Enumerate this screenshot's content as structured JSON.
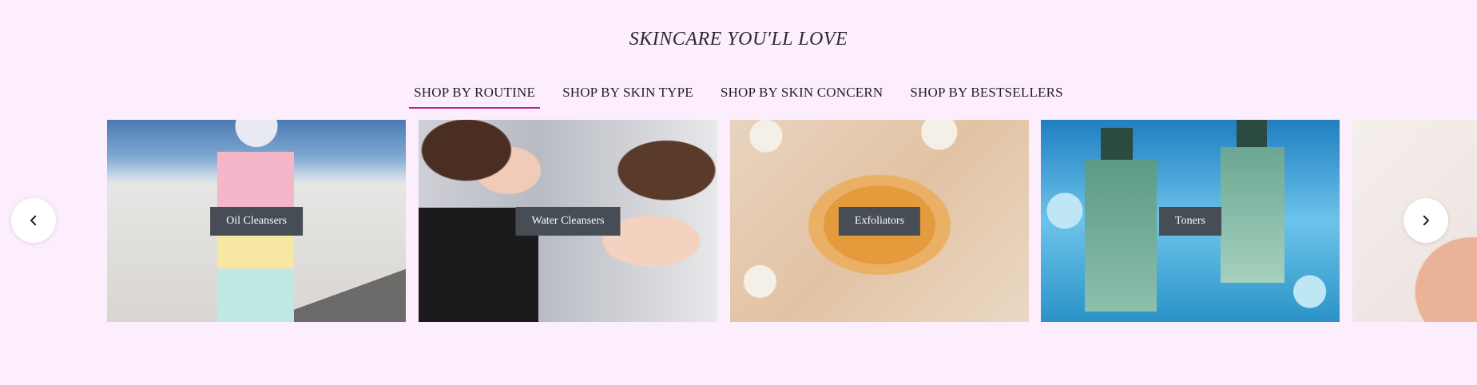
{
  "section": {
    "title": "SKINCARE YOU'LL LOVE"
  },
  "tabs": [
    {
      "label": "SHOP BY ROUTINE",
      "active": true
    },
    {
      "label": "SHOP BY SKIN TYPE",
      "active": false
    },
    {
      "label": "SHOP BY SKIN CONCERN",
      "active": false
    },
    {
      "label": "SHOP BY BESTSELLERS",
      "active": false
    }
  ],
  "carousel": {
    "cards": [
      {
        "label": "Oil Cleansers"
      },
      {
        "label": "Water Cleansers"
      },
      {
        "label": "Exfoliators"
      },
      {
        "label": "Toners"
      },
      {
        "label": ""
      }
    ],
    "prev_icon": "chevron-left-icon",
    "next_icon": "chevron-right-icon"
  },
  "colors": {
    "background": "#fdeefe",
    "active_tab_underline": "#c2189a",
    "label_bg": "#474d55",
    "label_text": "#ffffff"
  }
}
